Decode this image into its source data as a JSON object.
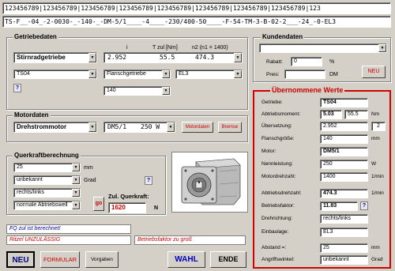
{
  "top": {
    "ruler_line": "123456789|123456789|123456789|123456789|123456789|123456789|123456789|123456789|123",
    "code_line": "TS-F__-04_-2-0030-_-140-_-DM-5/1____-4____-230/400-50____-F-54-TM-3-B-02-2___-24_-0-EL3"
  },
  "getriebe": {
    "title": "Getriebedaten",
    "type_value": "Stirnradgetriebe",
    "series_value": "TS04",
    "col_i": "i",
    "col_t": "T zul [Nm]",
    "col_n2": "n2 (n1 = 1400)",
    "i_value": "2.952",
    "t_value": "55.5",
    "n2_value": "474.3",
    "flange_value": "Flanschgetriebe",
    "el_value": "EL3",
    "size_value": "140",
    "help": "?"
  },
  "motor": {
    "title": "Motordaten",
    "type_value": "Drehstrommotor",
    "motor_value": "DM5/1",
    "power_value": "250 W",
    "btn_motordaten": "Motordaten",
    "btn_bremse": "Bremse"
  },
  "querkraft": {
    "title": "Querkraftberechnung",
    "val1": "25",
    "unit1": "mm",
    "val2": "unbekannt",
    "unit2": "Grad",
    "val3": "rechts/links",
    "val4": "normale Abtriebswell",
    "go": "go",
    "zul_label": "Zul. Querkraft:",
    "zul_value": "1620",
    "zul_unit": "N",
    "help": "?"
  },
  "status": {
    "line1": "FQ zul ist berechnet!",
    "line2": "Ritzel UNZULÄSSIG",
    "line3": "Betriebsfaktor zu groß"
  },
  "buttons": {
    "neu": "NEU",
    "formular": "FORMULAR",
    "vorgaben": "Vorgaben",
    "wahl": "WAHL",
    "ende": "ENDE"
  },
  "kunden": {
    "title": "Kundendaten",
    "rabatt_label": "Rabatt:",
    "rabatt_value": "0",
    "rabatt_unit": "%",
    "preis_label": "Preis:",
    "preis_unit": "DM",
    "neu": "NEU"
  },
  "uebernommen": {
    "title": "Übernommene Werte",
    "getriebe_label": "Getriebe:",
    "getriebe_value": "TS04",
    "moment_label": "Abtriebsmoment:",
    "moment_value": "5.03",
    "moment_value2": "55.5",
    "moment_unit": "Nm",
    "ueber_label": "Übersetzung:",
    "ueber_value": "2.952",
    "ueber_value2": "2",
    "flansch_label": "Flanschgröße:",
    "flansch_value": "140",
    "flansch_unit": "mm",
    "motor_label": "Motor:",
    "motor_value": "DM5/1",
    "nenn_label": "Nennleistung:",
    "nenn_value": "250",
    "nenn_unit": "W",
    "mdz_label": "Motordrehzahl:",
    "mdz_value": "1400",
    "mdz_unit": "1/min",
    "adz_label": "Abtriebsdrehzahl:",
    "adz_value": "474.3",
    "adz_unit": "1/min",
    "bf_label": "Betriebsfaktor:",
    "bf_value": "11.83",
    "dr_label": "Drehrichtung:",
    "dr_value": "rechts/links",
    "einbau_label": "Einbaulage:",
    "einbau_value": "EL3",
    "abstand_label": "Abstand =:",
    "abstand_value": "25",
    "abstand_unit": "mm",
    "winkel_label": "Angriffswinkel:",
    "winkel_value": "unbekannt",
    "winkel_unit": "Grad"
  }
}
